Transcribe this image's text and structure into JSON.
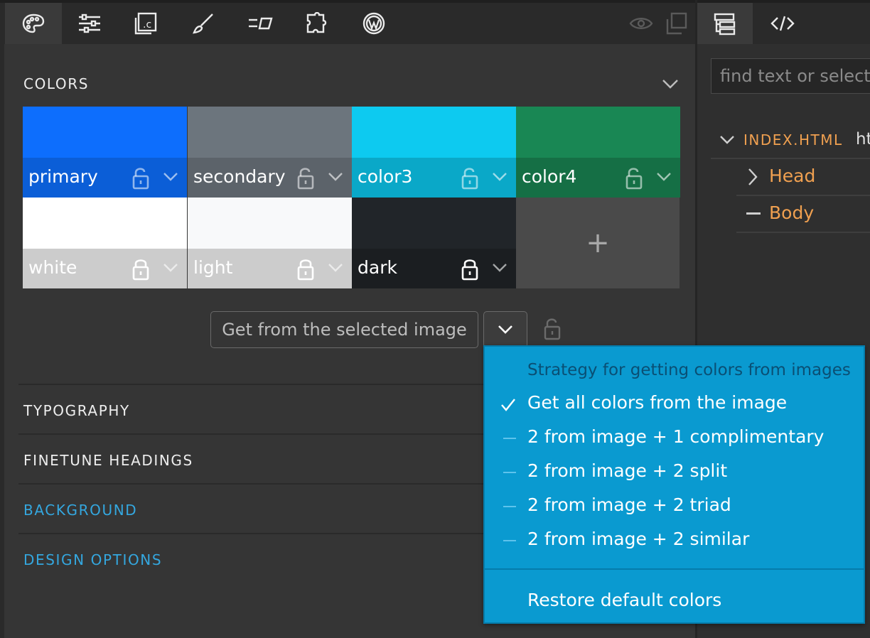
{
  "toolbar": {
    "tools": [
      "palette-icon",
      "sliders-icon",
      "css-file-icon",
      "brush-icon",
      "text-lines-icon",
      "puzzle-icon",
      "wordpress-icon"
    ],
    "right_tools": [
      "eye-icon",
      "duplicate-icon"
    ]
  },
  "colors_section": {
    "title": "COLORS",
    "swatches": [
      {
        "name": "primary",
        "color": "#0d6efd",
        "bar": "#0b5ed7",
        "locked": false
      },
      {
        "name": "secondary",
        "color": "#6c757d",
        "bar": "#5c636a",
        "locked": false
      },
      {
        "name": "color3",
        "color": "#0dcaf0",
        "bar": "#0aa8c8",
        "locked": false
      },
      {
        "name": "color4",
        "color": "#198754",
        "bar": "#156f45",
        "locked": false
      },
      {
        "name": "white",
        "color": "#ffffff",
        "bar": "#cccccc",
        "locked": true
      },
      {
        "name": "light",
        "color": "#f8f9fa",
        "bar": "#cccccc",
        "locked": true
      },
      {
        "name": "dark",
        "color": "#212529",
        "bar": "#1b1e21",
        "locked": true
      }
    ],
    "add_label": "+",
    "get_button": "Get from the selected image"
  },
  "sections": [
    {
      "title": "TYPOGRAPHY",
      "color": "#ededed"
    },
    {
      "title": "FINETUNE HEADINGS",
      "color": "#ededed"
    },
    {
      "title": "BACKGROUND",
      "color": "#34a7df"
    },
    {
      "title": "DESIGN OPTIONS",
      "color": "#34a7df"
    }
  ],
  "dropdown": {
    "header": "Strategy for getting colors from images",
    "items": [
      {
        "label": "Get all colors from the image",
        "checked": true
      },
      {
        "label": "2 from image + 1 complimentary",
        "checked": false
      },
      {
        "label": "2 from image + 2 split",
        "checked": false
      },
      {
        "label": "2 from image + 2 triad",
        "checked": false
      },
      {
        "label": "2 from image + 2 similar",
        "checked": false
      }
    ],
    "restore": "Restore default colors"
  },
  "right_panel": {
    "search_placeholder": "find text or selector",
    "tree": {
      "root": "INDEX.HTML",
      "root_suffix": "ht",
      "children": [
        "Head",
        "Body"
      ]
    }
  }
}
